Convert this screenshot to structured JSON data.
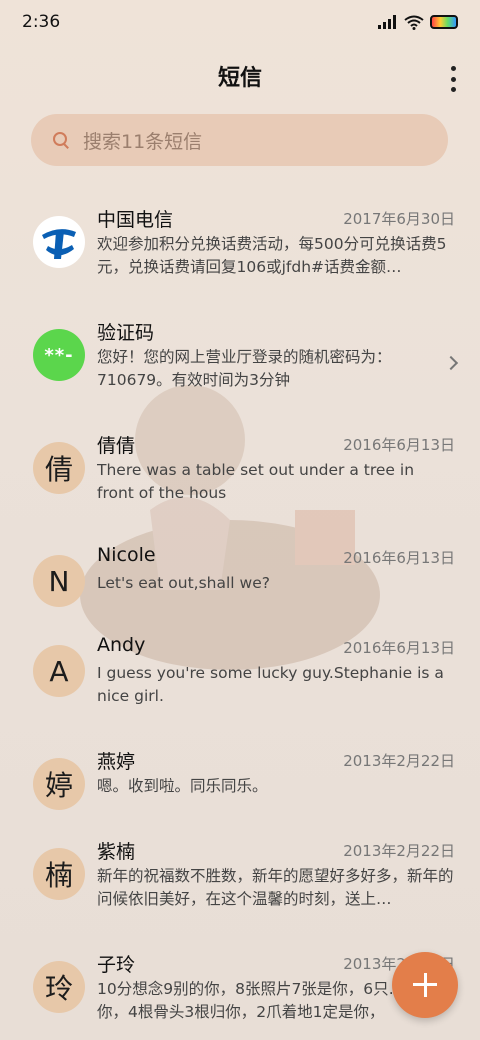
{
  "status_bar": {
    "time": "2:36",
    "icons": [
      "signal-icon",
      "wifi-icon",
      "battery-icon"
    ]
  },
  "header": {
    "title": "短信",
    "menu_icon": "more-vertical-icon"
  },
  "search": {
    "placeholder": "搜索11条短信",
    "icon": "search-icon"
  },
  "messages": [
    {
      "name": "中国电信",
      "date": "2017年6月30日",
      "preview": "欢迎参加积分兑换话费活动，每500分可兑换话费5元，兑换话费请回复106或jfdh#话费金额…",
      "avatar": ""
    },
    {
      "name": "验证码",
      "date": "",
      "preview": "您好！您的网上营业厅登录的随机密码为：710679。有效时间为3分钟",
      "avatar": "**-"
    },
    {
      "name": "倩倩",
      "date": "2016年6月13日",
      "preview": "There was a table set out under a tree in front of the hous",
      "avatar": "倩"
    },
    {
      "name": "Nicole",
      "date": "2016年6月13日",
      "preview": "Let's eat out,shall we?",
      "avatar": "N"
    },
    {
      "name": "Andy",
      "date": "2016年6月13日",
      "preview": "I guess you're some lucky guy.Stephanie is a nice girl.",
      "avatar": "A"
    },
    {
      "name": "燕婷",
      "date": "2013年2月22日",
      "preview": "嗯。收到啦。同乐同乐。",
      "avatar": "婷"
    },
    {
      "name": "紫楠",
      "date": "2013年2月22日",
      "preview": "新年的祝福数不胜数，新年的愿望好多好多，新年的问候依旧美好，在这个温馨的时刻，送上…",
      "avatar": "楠"
    },
    {
      "name": "子玲",
      "date": "2013年2月22日",
      "preview": "10分想念9别的你，8张照片7张是你，6只…只像你，4根骨头3根归你，2爪着地1定是你，",
      "avatar": "玲"
    }
  ],
  "colors": {
    "accent": "#e37e4a",
    "search_bg": "#e8cbb7",
    "avatar_bg": "#e7c8a9",
    "code_avatar": "#5bd64c",
    "telecom_blue": "#0a5fb4"
  }
}
